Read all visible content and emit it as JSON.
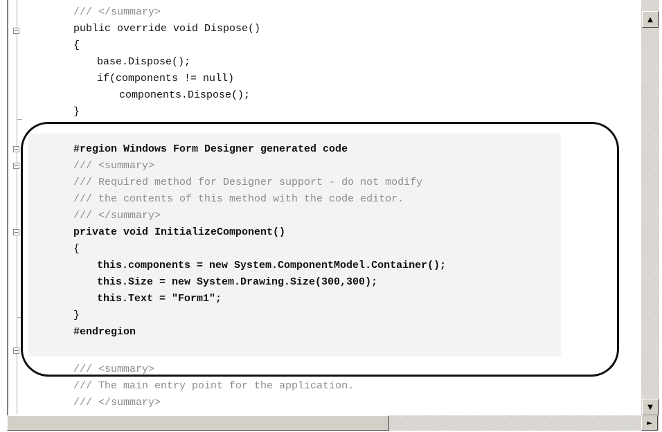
{
  "code_lines": [
    "/// </summary>",
    "public override void Dispose()",
    "{",
    "base.Dispose();",
    "if(components != null)",
    "components.Dispose();",
    "}",
    "#region Windows Form Designer generated code",
    "/// <summary>",
    "/// Required method for Designer support - do not modify",
    "/// the contents of this method with the code editor.",
    "/// </summary>",
    "private void InitializeComponent()",
    "{",
    "this.components = new System.ComponentModel.Container();",
    "this.Size = new System.Drawing.Size(300,300);",
    "this.Text = \"Form1\";",
    "}",
    "#endregion",
    "/// <summary>",
    "/// The main entry point for the application.",
    "/// </summary>"
  ],
  "scrollbar": {
    "up_arrow": "▲",
    "down_arrow": "▼",
    "right_arrow": "►"
  },
  "icons": {
    "fold": "collapse-box-icon",
    "up": "arrow-up-icon",
    "down": "arrow-down-icon",
    "right": "arrow-right-icon"
  },
  "colors": {
    "comment": "#8c8c8c",
    "code": "#111111",
    "region_highlight": "#f3f3f3",
    "callout_border": "#111111"
  },
  "horizontal_scroll_position": 0.0
}
